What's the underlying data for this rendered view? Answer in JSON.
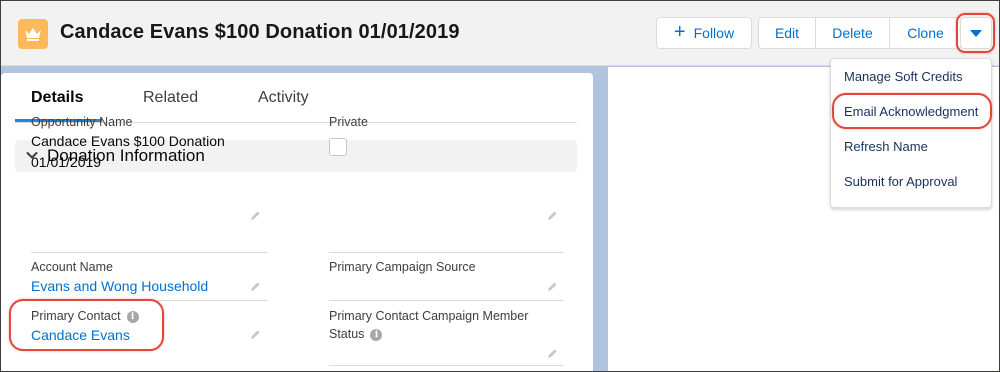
{
  "record": {
    "title": "Candace Evans $100 Donation 01/01/2019",
    "icon": "crown-icon",
    "icon_color": "#fcb95b"
  },
  "actions": {
    "follow": "Follow",
    "edit": "Edit",
    "delete": "Delete",
    "clone": "Clone"
  },
  "dropdown_menu": {
    "items": [
      "Manage Soft Credits",
      "Email Acknowledgment",
      "Refresh Name",
      "Submit for Approval"
    ]
  },
  "tabs": [
    "Details",
    "Related",
    "Activity"
  ],
  "section": {
    "title": "Donation Information"
  },
  "fields": {
    "opportunity_name": {
      "label": "Opportunity Name",
      "value_line1": "Candace Evans $100 Donation",
      "value_line2": "01/01/2019"
    },
    "private": {
      "label": "Private",
      "checked": false
    },
    "account_name": {
      "label": "Account Name",
      "value": "Evans and Wong Household"
    },
    "primary_campaign_source": {
      "label": "Primary Campaign Source",
      "value": ""
    },
    "primary_contact": {
      "label": "Primary Contact",
      "value": "Candace Evans"
    },
    "primary_contact_campaign_member_status": {
      "label_line1": "Primary Contact Campaign Member",
      "label_line2": "Status"
    }
  },
  "colors": {
    "link": "#0070d2",
    "highlight": "#e0483c",
    "active_tab": "#1589ee"
  }
}
